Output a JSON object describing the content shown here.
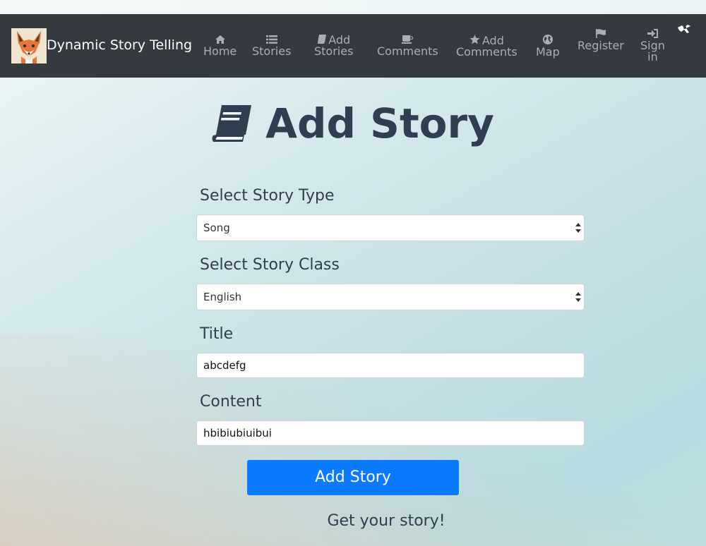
{
  "navbar": {
    "brand": "Dynamic Story Telling",
    "logo_icon": "fox-logo-icon",
    "items": [
      {
        "icon": "home-icon",
        "label1": "Home",
        "label2": ""
      },
      {
        "icon": "list-icon",
        "label1": "Stories",
        "label2": ""
      },
      {
        "icon": "book-icon",
        "label1": "Add",
        "label2": "Stories"
      },
      {
        "icon": "coffee-icon",
        "label1": "Comments",
        "label2": ""
      },
      {
        "icon": "star-icon",
        "label1": "Add",
        "label2": "Comments"
      },
      {
        "icon": "globe-icon",
        "label1": "Map",
        "label2": ""
      },
      {
        "icon": "flag-icon",
        "label1": "Register",
        "label2": ""
      },
      {
        "icon": "sign-in-icon",
        "label1": "Sign",
        "label2": "in"
      }
    ],
    "corner_icon": "extension-icon"
  },
  "page": {
    "title": "Add Story",
    "title_icon": "book-icon"
  },
  "form": {
    "type_label": "Select Story Type",
    "type_value": "Song",
    "class_label": "Select Story Class",
    "class_value": "English",
    "title_label": "Title",
    "title_value": "abcdefg",
    "content_label": "Content",
    "content_value": "hbibiubiuibui",
    "submit_label": "Add Story"
  },
  "footer": {
    "tagline": "Get your story!"
  },
  "colors": {
    "navbar_bg": "#343a40",
    "nav_text": "#a8aeb3",
    "accent": "#0a7bff",
    "heading": "#2f3e50"
  }
}
